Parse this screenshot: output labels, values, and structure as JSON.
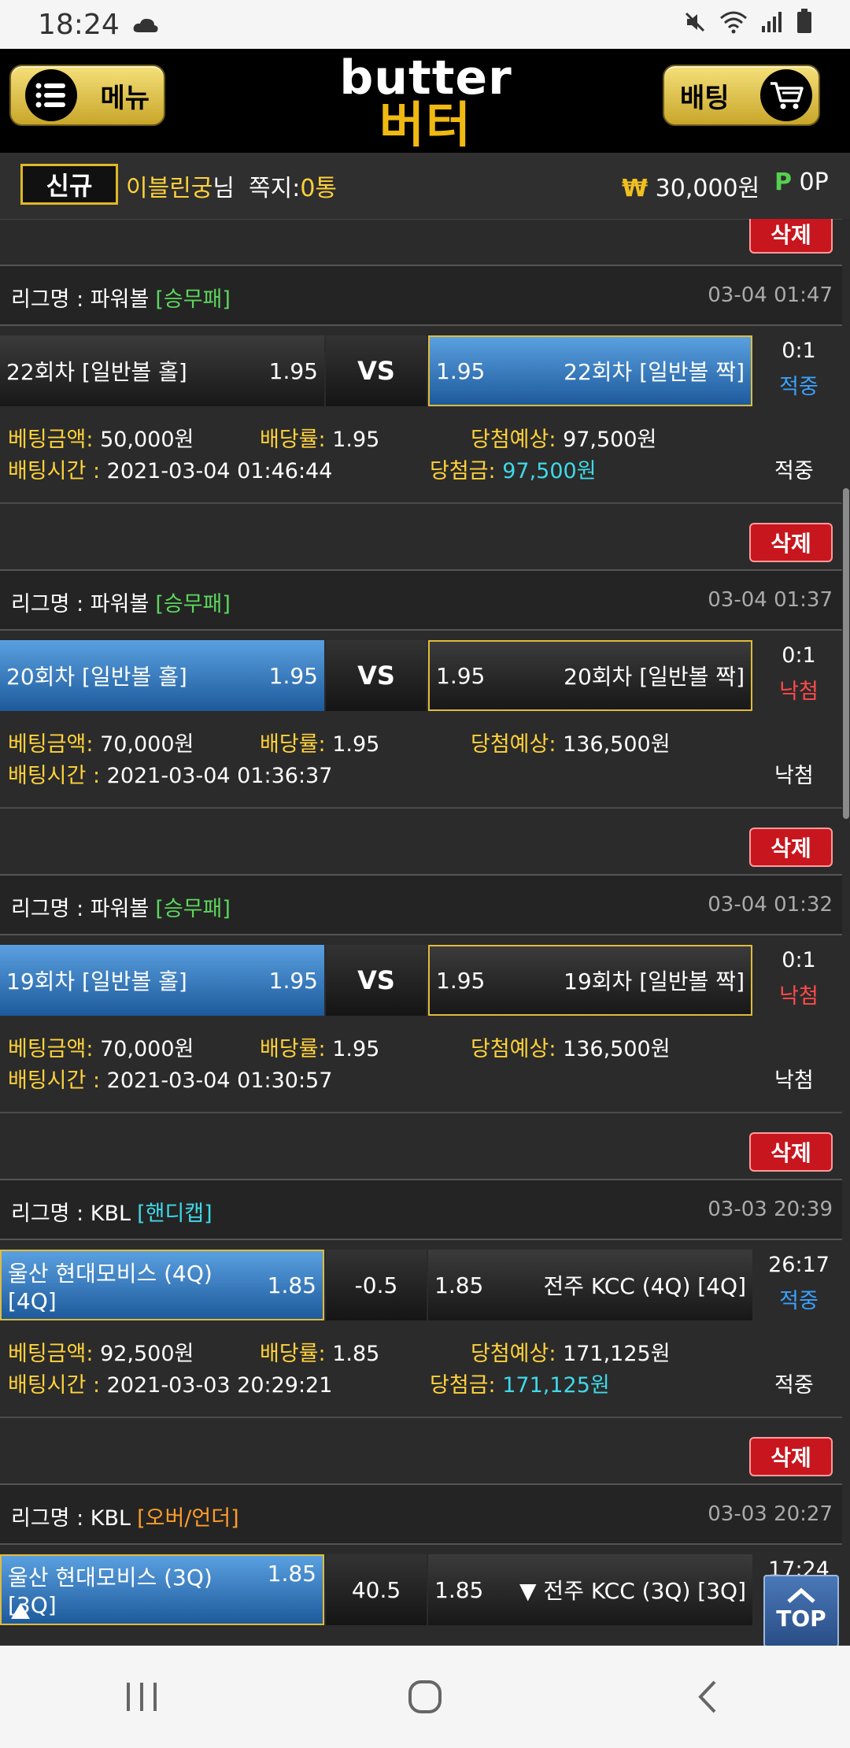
{
  "status_bar": {
    "time": "18:24"
  },
  "header": {
    "menu_label": "메뉴",
    "bet_label": "배팅",
    "logo_top": "butter",
    "logo_bottom": "버터"
  },
  "user_bar": {
    "badge": "신규",
    "name": "이블린궁",
    "name_suffix": "님",
    "note_label": "쪽지:",
    "note_count": "0통",
    "money": "30,000원",
    "point_sign": "P",
    "point": "0P"
  },
  "common": {
    "delete_label": "삭제",
    "league_prefix": "리그명 : ",
    "vs": "VS",
    "bet_amount_label": "베팅금액:",
    "odds_label": "배당률:",
    "expected_label": "당첨예상:",
    "time_label": "배팅시간 :",
    "prize_label": "당첨금:"
  },
  "bets": [
    {
      "league": "파워볼",
      "type": "[승무패]",
      "date": "03-04 01:47",
      "home": "22회차 [일반볼 홀]",
      "home_odds": "1.95",
      "mid": "VS",
      "away_odds": "1.95",
      "away": "22회차 [일반볼 짝]",
      "score": "0:1",
      "result": "적중",
      "amount": "50,000원",
      "odds": "1.95",
      "expected": "97,500원",
      "bet_time": "2021-03-04 01:46:44",
      "prize": "97,500원",
      "status": "적중"
    },
    {
      "league": "파워볼",
      "type": "[승무패]",
      "date": "03-04 01:37",
      "home": "20회차 [일반볼 홀]",
      "home_odds": "1.95",
      "mid": "VS",
      "away_odds": "1.95",
      "away": "20회차 [일반볼 짝]",
      "score": "0:1",
      "result": "낙첨",
      "amount": "70,000원",
      "odds": "1.95",
      "expected": "136,500원",
      "bet_time": "2021-03-04 01:36:37",
      "status": "낙첨"
    },
    {
      "league": "파워볼",
      "type": "[승무패]",
      "date": "03-04 01:32",
      "home": "19회차 [일반볼 홀]",
      "home_odds": "1.95",
      "mid": "VS",
      "away_odds": "1.95",
      "away": "19회차 [일반볼 짝]",
      "score": "0:1",
      "result": "낙첨",
      "amount": "70,000원",
      "odds": "1.95",
      "expected": "136,500원",
      "bet_time": "2021-03-04 01:30:57",
      "status": "낙첨"
    },
    {
      "league": "KBL",
      "type": "[핸디캡]",
      "date": "03-03 20:39",
      "home": "울산 현대모비스 (4Q) [4Q]",
      "home_odds": "1.85",
      "mid": "-0.5",
      "away_odds": "1.85",
      "away": "전주 KCC (4Q) [4Q]",
      "score": "26:17",
      "result": "적중",
      "amount": "92,500원",
      "odds": "1.85",
      "expected": "171,125원",
      "bet_time": "2021-03-03 20:29:21",
      "prize": "171,125원",
      "status": "적중"
    },
    {
      "league": "KBL",
      "type": "[오버/언더]",
      "date": "03-03 20:27",
      "home": "울산 현대모비스 (3Q) [3Q]",
      "home_odds": "1.85",
      "mid": "40.5",
      "away_odds": "1.85",
      "away": "▼ 전주 KCC (3Q) [3Q]",
      "score": "17:24"
    }
  ],
  "top_button": "TOP",
  "colors": {
    "accent_gold": "#ffd23a",
    "win_blue": "#3aa0ff",
    "lose_red": "#ff4a4a",
    "delete_red": "#c8161e"
  }
}
